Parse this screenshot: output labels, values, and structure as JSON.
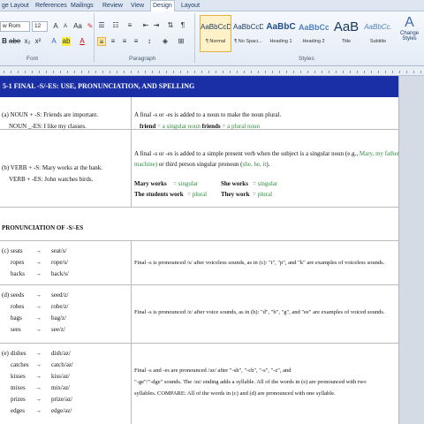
{
  "ribbon": {
    "tabs": [
      "ge Layout",
      "References",
      "Mailings",
      "Review",
      "View",
      "Design",
      "Layout"
    ],
    "font_name": "w Rom",
    "font_size": "12",
    "groups": {
      "font": "Font",
      "paragraph": "Paragraph",
      "styles": "Styles"
    },
    "styles": [
      {
        "preview": "AaBbCcDc",
        "name": "¶ Normal"
      },
      {
        "preview": "AaBbCcDc",
        "name": "¶ No Spaci..."
      },
      {
        "preview": "AaBbC",
        "name": "Heading 1"
      },
      {
        "preview": "AaBbCc",
        "name": "Heading 2"
      },
      {
        "preview": "AaB",
        "name": "Title"
      },
      {
        "preview": "AaBbCc.",
        "name": "Subtitle"
      }
    ],
    "change_styles": "Change Styles"
  },
  "doc": {
    "banner": "5-1   FINAL  -S/-ES:  USE, PRONUNCIATION,  AND SPELLING",
    "section_a": {
      "l1": "(a)  NOUN + -S:    Friends are important.",
      "l2": "NOUN  _-ES:  I like my classes.",
      "r1": "A final -s or -es is added to a noun to make the noun plural.",
      "r2a": "friend",
      "r2b": "= a singular noun",
      "r2c": "friends",
      "r2d": "= a plural noun"
    },
    "section_b": {
      "l1": "(b)  VERB + -S:    Mary works at the bank.",
      "l2": "VERB + -ES: John watches birds.",
      "r1": "A final -s or -es is added to a simple present verb when the subject is a singular noun (e.g.,",
      "r1g": "Mary, my father, the",
      "r2g": "machine)",
      "r2": "or third person singular pronoun (",
      "r2p": "she, he, it",
      "r3a": "Mary works",
      "r3b": "= singular",
      "r3c": "She works",
      "r3d": "= singular",
      "r4a": "The students work",
      "r4b": "= plural",
      "r4c": "They work",
      "r4d": "= plural"
    },
    "pron_heading": "PRONUNCIATION  OF  -S/-ES",
    "section_c": {
      "label": "(c)",
      "words": [
        "seats",
        "ropes",
        "backs"
      ],
      "results": [
        "seat/s/",
        "rope/s/",
        "back/s/"
      ],
      "note": "Final -s is pronounced /s/ after voiceless sounds, as in (c): \"t\", \"p\", and \"k\" are examples of voiceless sounds."
    },
    "section_d": {
      "label": "(d)",
      "words": [
        "seeds",
        "robes",
        "bags",
        "sees"
      ],
      "results": [
        "seed/z/",
        "robe/z/",
        "bag/z/",
        "see/z/"
      ],
      "note": "Final -s is pronounced /z/ after voice sounds, as in (h): \"d\", \"b\", \"g\", and \"ee\" are examples of voiced sounds."
    },
    "section_e": {
      "label": "(e)",
      "words": [
        "dishes",
        "catches",
        "kisses",
        "mixes",
        "prizes",
        "edges"
      ],
      "results": [
        "dish/əz/",
        "catch/əz/",
        "kiss/əz/",
        "mix/əz/",
        "prize/əz/",
        "edge/əz/"
      ],
      "note1": "Final -s and -es are pronounced /əz/ after \"-sh\", \"-ch\", \"-s\", \"-z\", and",
      "note2": "\"-ge\"/\"-dge\"  sounds.  The /əz/ ending adds a syllable.  All of the words in (e) are pronounced with two",
      "note3": "syllables.  COMPARE:  All  of the words in (c) and (d) are pronounced with one syllable."
    },
    "arrow": "→"
  }
}
